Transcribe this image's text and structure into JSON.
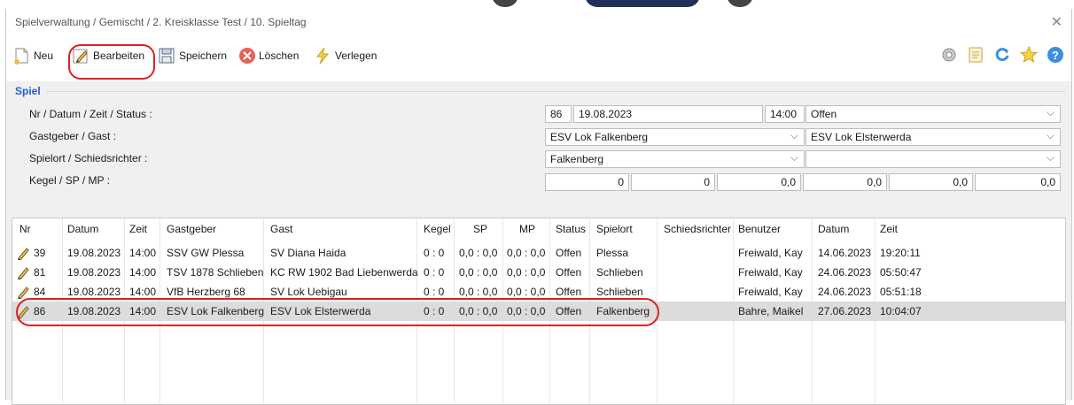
{
  "window": {
    "title": "Spielverwaltung / Gemischt / 2. Kreisklasse Test / 10. Spieltag",
    "close_icon": "close-icon"
  },
  "toolbar": {
    "new_label": "Neu",
    "edit_label": "Bearbeiten",
    "save_label": "Speichern",
    "delete_label": "Löschen",
    "move_label": "Verlegen",
    "right_icons": [
      "gear-icon",
      "list-icon",
      "refresh-icon",
      "star-icon",
      "help-icon"
    ]
  },
  "spiel": {
    "group_label": "Spiel",
    "labels": {
      "nr_datum": "Nr / Datum / Zeit / Status :",
      "gastgeber_gast": "Gastgeber / Gast :",
      "spielort": "Spielort / Schiedsrichter :",
      "kegel": "Kegel / SP / MP :"
    },
    "nr": "86",
    "datum": "19.08.2023",
    "zeit": "14:00",
    "status": "Offen",
    "gastgeber": "ESV Lok Falkenberg",
    "gast": "ESV Lok Elsterwerda",
    "spielort": "Falkenberg",
    "schiedsrichter": "",
    "kegel_1": "0",
    "kegel_2": "0",
    "sp_1": "0,0",
    "sp_2": "0,0",
    "mp_1": "0,0",
    "mp_2": "0,0"
  },
  "grid": {
    "headers": [
      "Nr",
      "Datum",
      "Zeit",
      "Gastgeber",
      "Gast",
      "Kegel",
      "SP",
      "MP",
      "Status",
      "Spielort",
      "Schiedsrichter",
      "Benutzer",
      "Datum",
      "Zeit"
    ],
    "rows": [
      [
        "39",
        "19.08.2023",
        "14:00",
        "SSV GW Plessa",
        "SV Diana Haida",
        "0 : 0",
        "0,0 : 0,0",
        "0,0 : 0,0",
        "Offen",
        "Plessa",
        "",
        "Freiwald, Kay",
        "14.06.2023",
        "19:20:11"
      ],
      [
        "81",
        "19.08.2023",
        "14:00",
        "TSV 1878 Schlieben",
        "KC RW 1902 Bad Liebenwerda",
        "0 : 0",
        "0,0 : 0,0",
        "0,0 : 0,0",
        "Offen",
        "Schlieben",
        "",
        "Freiwald, Kay",
        "24.06.2023",
        "05:50:47"
      ],
      [
        "84",
        "19.08.2023",
        "14:00",
        "VfB Herzberg 68",
        "SV Lok Uebigau",
        "0 : 0",
        "0,0 : 0,0",
        "0,0 : 0,0",
        "Offen",
        "Schlieben",
        "",
        "Freiwald, Kay",
        "24.06.2023",
        "05:51:18"
      ],
      [
        "86",
        "19.08.2023",
        "14:00",
        "ESV Lok Falkenberg",
        "ESV Lok Elsterwerda",
        "0 : 0",
        "0,0 : 0,0",
        "0,0 : 0,0",
        "Offen",
        "Falkenberg",
        "",
        "Bahre, Maikel",
        "27.06.2023",
        "10:04:07"
      ]
    ],
    "selected_row": 3
  },
  "colors": {
    "accent": "#2a5bd7",
    "annotation": "#e02020",
    "selected_row": "#dcdcdc"
  }
}
